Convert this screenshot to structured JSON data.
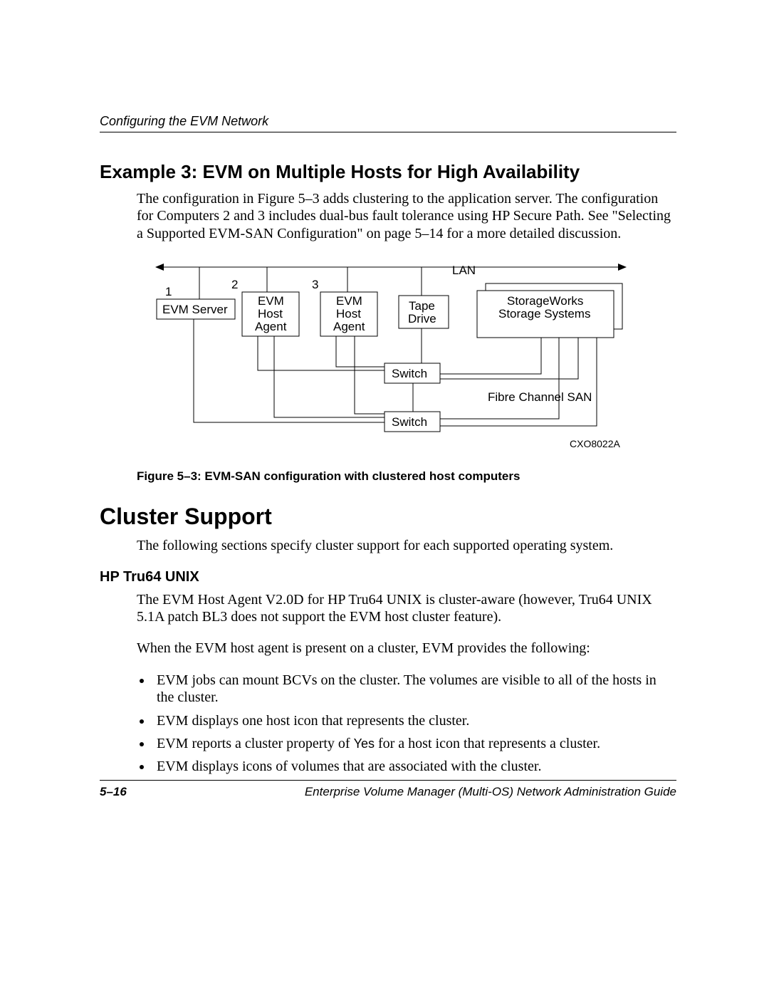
{
  "header": {
    "running": "Configuring the EVM Network"
  },
  "example": {
    "title": "Example 3: EVM on Multiple Hosts for High Availability",
    "para": "The configuration in Figure 5–3 adds clustering to the application server. The configuration for Computers 2 and 3 includes dual-bus fault tolerance using HP Secure Path. See \"Selecting a Supported EVM-SAN Configuration\" on page 5–14 for a more detailed discussion."
  },
  "diagram": {
    "lan": "LAN",
    "index1": "1",
    "index2": "2",
    "index3": "3",
    "evm_server": "EVM Server",
    "host_agent_l1": "EVM",
    "host_agent_l2": "Host",
    "host_agent_l3": "Agent",
    "tape_l1": "Tape",
    "tape_l2": "Drive",
    "storage_l1": "StorageWorks",
    "storage_l2": "Storage Systems",
    "switch": "Switch",
    "fc_san": "Fibre Channel SAN",
    "code": "CXO8022A"
  },
  "figcaption": "Figure 5–3:  EVM-SAN configuration with clustered host computers",
  "cluster": {
    "heading": "Cluster Support",
    "intro": "The following sections specify cluster support for each supported operating system."
  },
  "tru64": {
    "heading": "HP Tru64 UNIX",
    "p1": "The EVM Host Agent V2.0D for HP Tru64 UNIX is cluster-aware (however, Tru64 UNIX 5.1A patch BL3 does not support the EVM host cluster feature).",
    "p2": "When the EVM host agent is present on a cluster, EVM provides the following:",
    "b1": "EVM jobs can mount BCVs on the cluster. The volumes are visible to all of the hosts in the cluster.",
    "b2": "EVM displays one host icon that represents the cluster.",
    "b3a": "EVM reports a cluster property of ",
    "b3yes": "Yes",
    "b3b": " for a host icon that represents a cluster.",
    "b4": "EVM displays icons of volumes that are associated with the cluster."
  },
  "footer": {
    "page": "5–16",
    "title": "Enterprise Volume Manager (Multi-OS) Network Administration Guide"
  }
}
